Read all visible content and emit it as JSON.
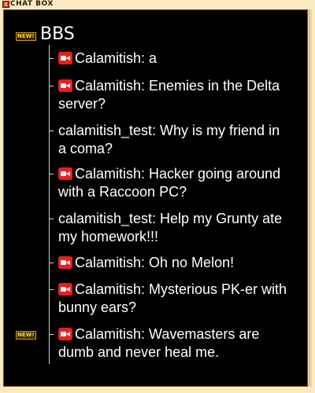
{
  "window": {
    "title": "CHAT BOX"
  },
  "bbs": {
    "badge": "NEW!",
    "title": "BBS"
  },
  "threads": [
    {
      "icon": "video-camera-icon",
      "text": "Calamitish: a"
    },
    {
      "icon": "video-camera-icon",
      "text": "Calamitish: Enemies in the Delta server?"
    },
    {
      "icon": "",
      "text": "calamitish_test: Why is my friend in a coma?"
    },
    {
      "icon": "video-camera-icon",
      "text": "Calamitish: Hacker going around with a Raccoon PC?"
    },
    {
      "icon": "",
      "text": "calamitish_test: Help my Grunty ate my homework!!!"
    },
    {
      "icon": "video-camera-icon",
      "text": "Calamitish: Oh no Melon!"
    },
    {
      "icon": "video-camera-icon",
      "text": "Calamitish: Mysterious PK-er with bunny ears?"
    },
    {
      "icon": "video-camera-icon",
      "text": "Calamitish: Wavemasters are dumb and never heal me.",
      "badge": "NEW!"
    }
  ],
  "colors": {
    "frame": "#fbeac0",
    "panel_background": "#000000",
    "text": "#ffffff",
    "badge": "#ffd24a",
    "video_icon": "#e8201a"
  }
}
